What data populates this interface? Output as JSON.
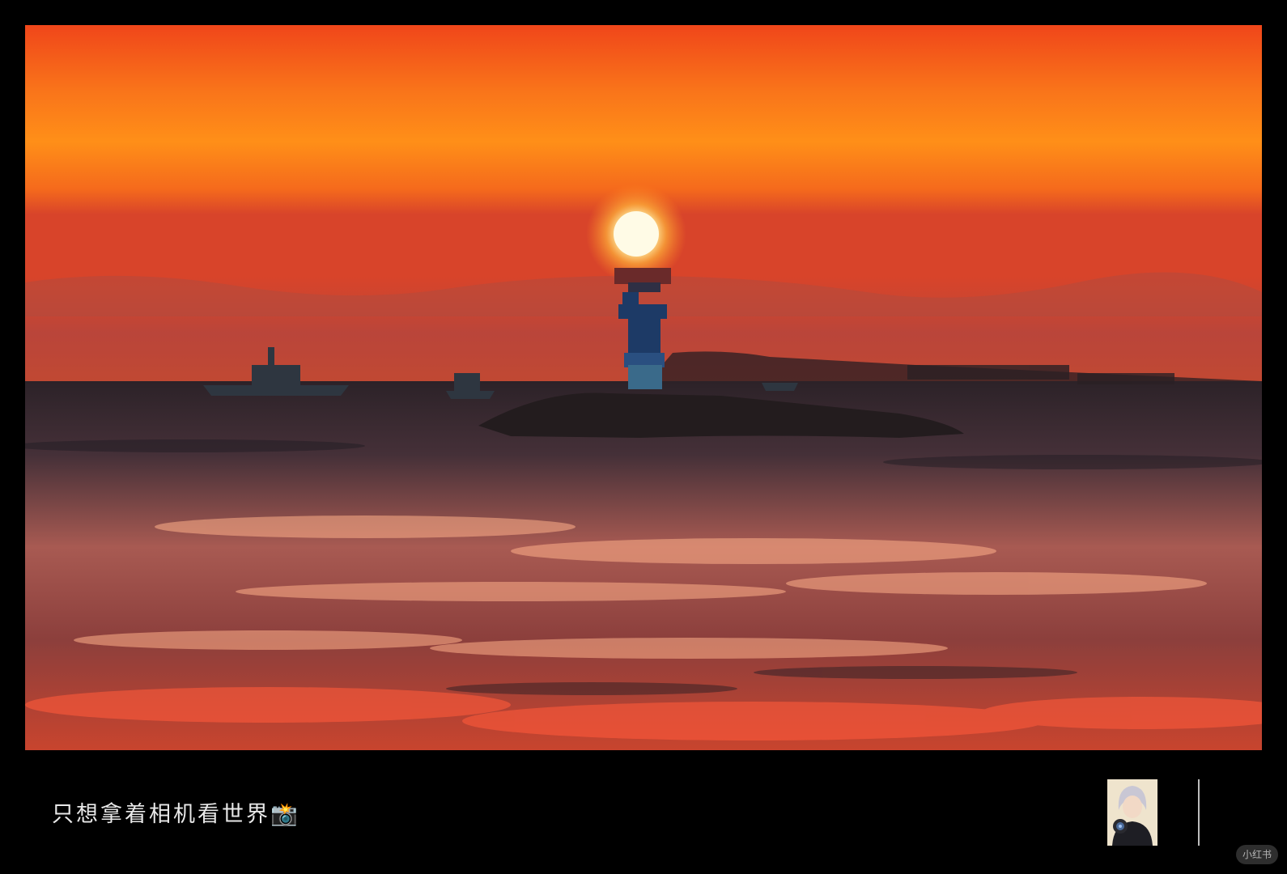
{
  "post": {
    "caption": "只想拿着相机看世界📸"
  },
  "author": {
    "avatar_icon": "user-avatar-icon"
  },
  "brand": {
    "watermark": "小红书"
  },
  "photo": {
    "subject": "sunset-lighthouse-sea",
    "colors": {
      "sky_top": "#f24a12",
      "sky_mid": "#ff8c14",
      "haze": "#c73a2a",
      "sun": "#fff6c8",
      "sea_dark": "#2a1f25",
      "sea_glow": "#ff6a3c"
    }
  }
}
